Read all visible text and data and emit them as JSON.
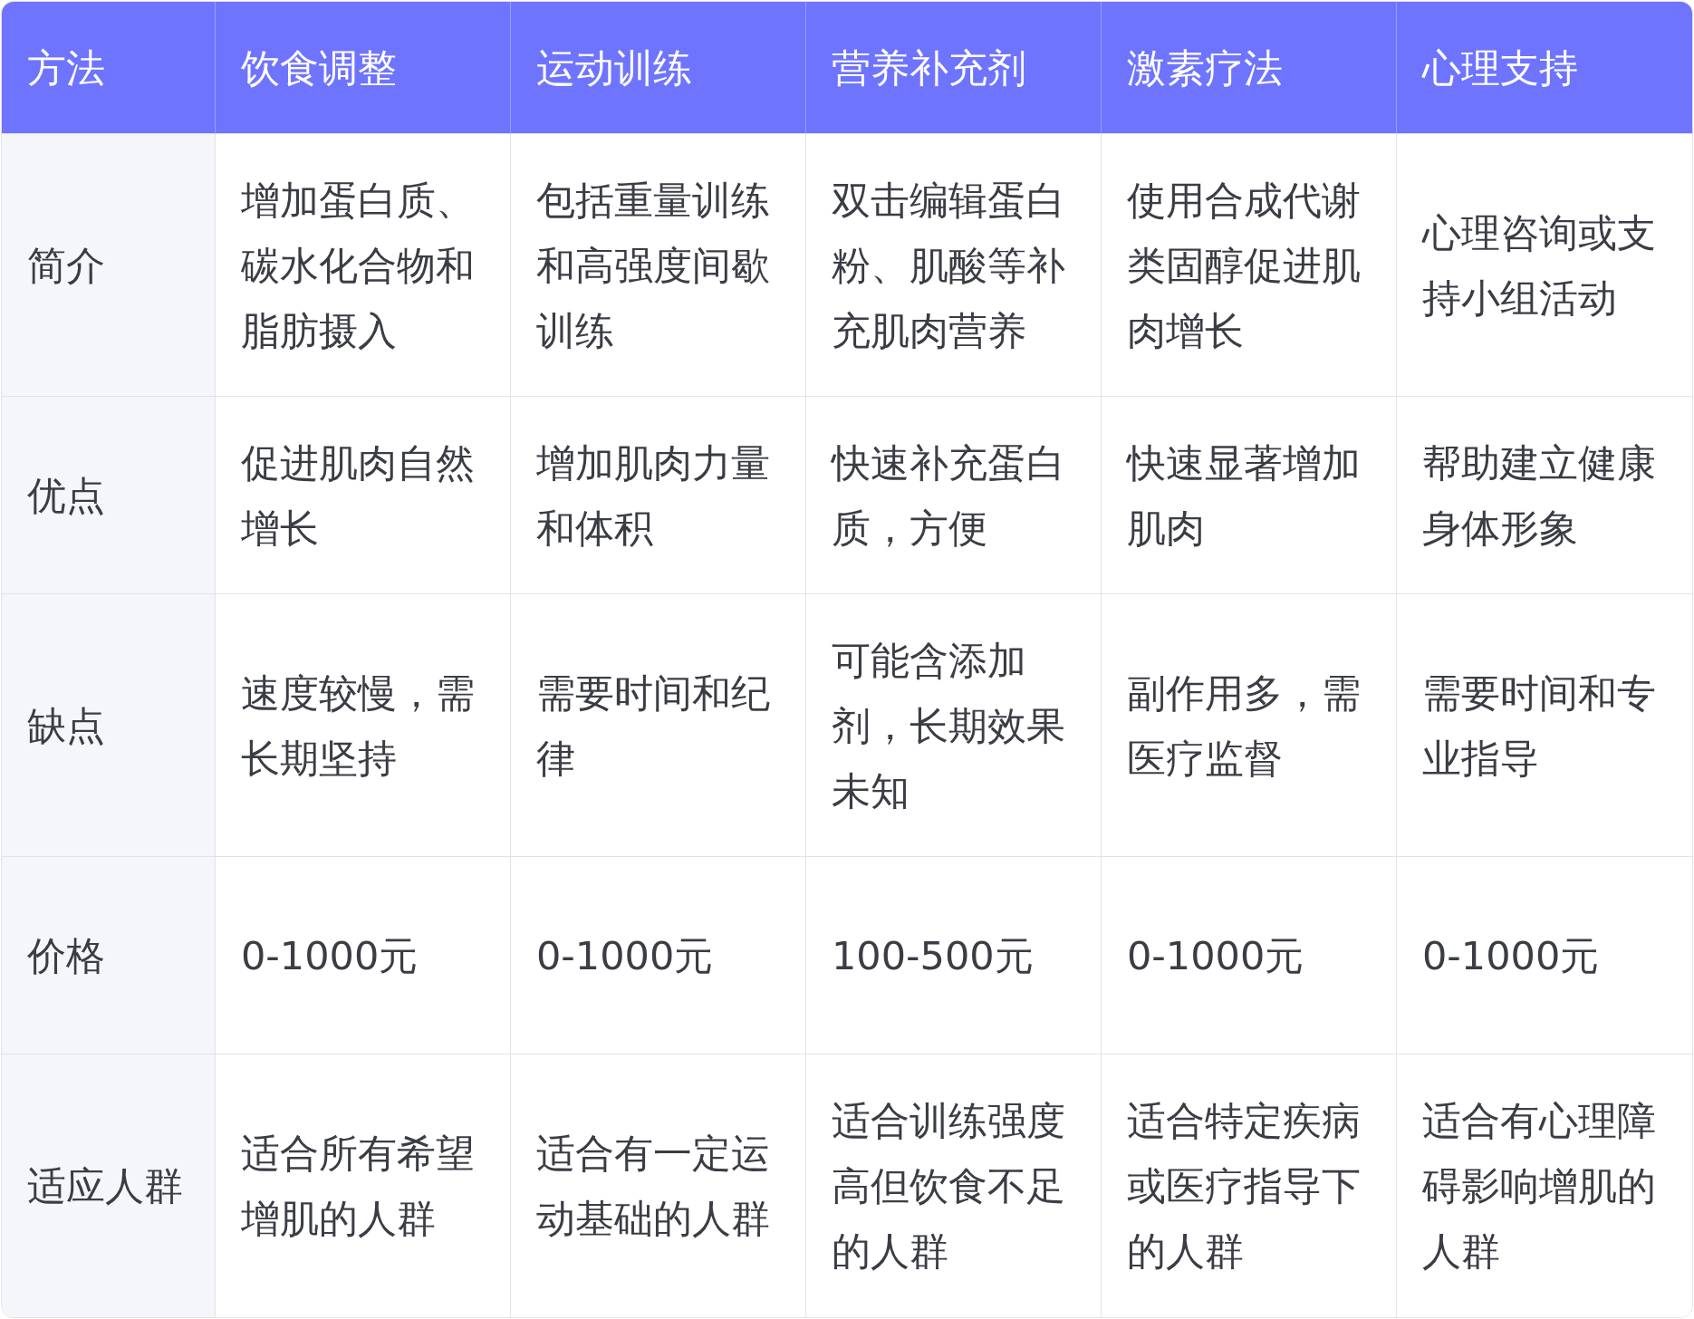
{
  "table": {
    "columns": [
      "方法",
      "饮食调整",
      "运动训练",
      "营养补充剂",
      "激素疗法",
      "心理支持"
    ],
    "rows": [
      [
        "简介",
        "增加蛋白质、碳水化合物和脂肪摄入",
        "包括重量训练和高强度间歇训练",
        "双击编辑蛋白粉、肌酸等补充肌肉营养",
        "使用合成代谢类固醇促进肌肉增长",
        "心理咨询或支持小组活动"
      ],
      [
        "优点",
        "促进肌肉自然增长",
        "增加肌肉力量和体积",
        "快速补充蛋白质，方便",
        "快速显著增加肌肉",
        "帮助建立健康身体形象"
      ],
      [
        "缺点",
        "速度较慢，需长期坚持",
        "需要时间和纪律",
        "可能含添加剂，长期效果未知",
        "副作用多，需医疗监督",
        "需要时间和专业指导"
      ],
      [
        "价格",
        "0-1000元",
        "0-1000元",
        "100-500元",
        "0-1000元",
        "0-1000元"
      ],
      [
        "适应人群",
        "适合所有希望增肌的人群",
        "适合有一定运动基础的人群",
        "适合训练强度高但饮食不足的人群",
        "适合特定疾病或医疗指导下的人群",
        "适合有心理障碍影响增肌的人群"
      ]
    ]
  }
}
